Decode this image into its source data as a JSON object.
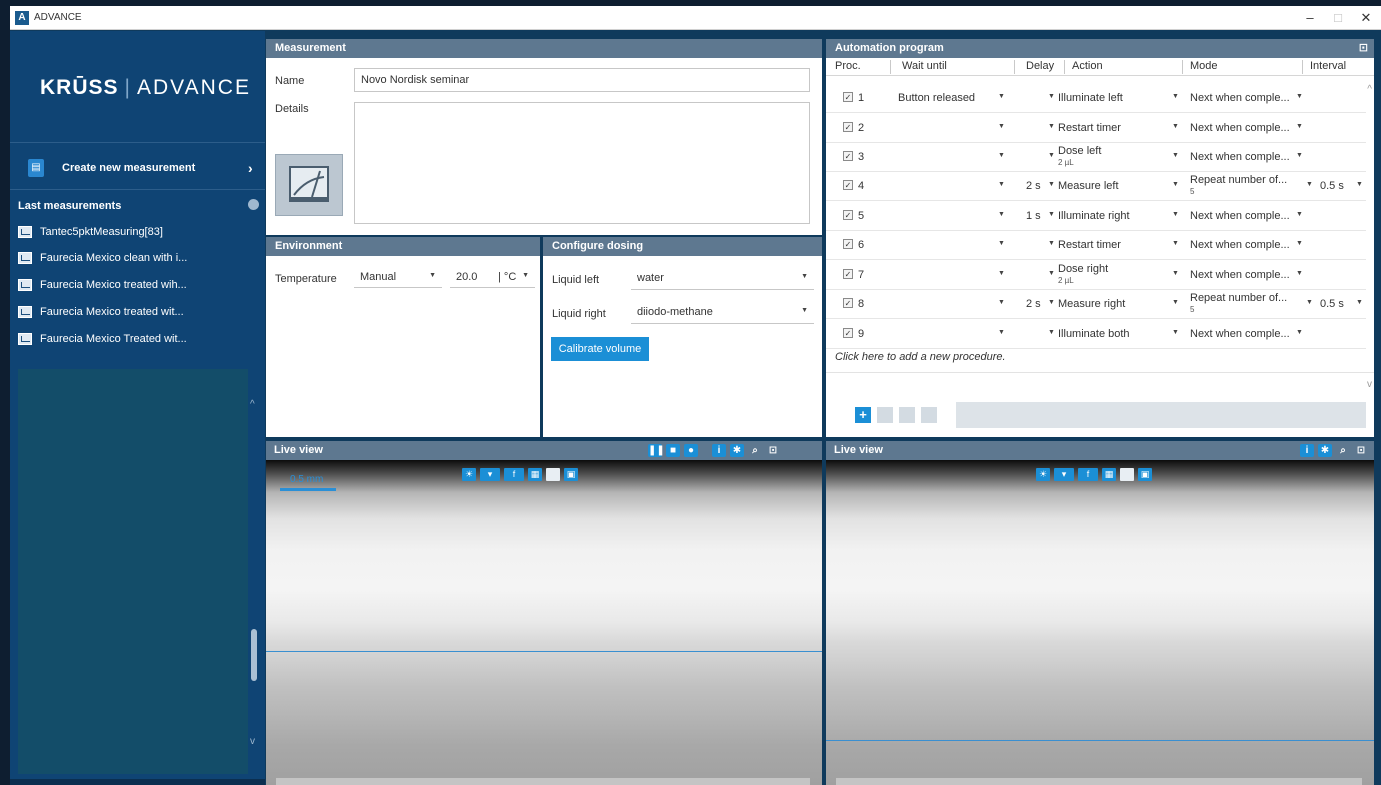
{
  "window": {
    "title": "ADVANCE",
    "app_icon_letter": "A",
    "minimize": "–",
    "maximize": "□",
    "close": "✕"
  },
  "sidebar": {
    "logo_brand": "KRŪSS",
    "logo_sep": "|",
    "logo_product": "ADVANCE",
    "create_label": "Create new measurement",
    "create_chevron": "›",
    "last_measurements_title": "Last measurements",
    "last_measurements": [
      "Tantec5pktMeasuring[83]",
      "Faurecia Mexico clean with i...",
      "Faurecia Mexico treated wih...",
      "Faurecia Mexico treated wit...",
      "Faurecia Mexico Treated wit..."
    ]
  },
  "measurement": {
    "title": "Measurement",
    "name_label": "Name",
    "name_value": "Novo Nordisk seminar",
    "details_label": "Details",
    "details_value": ""
  },
  "environment": {
    "title": "Environment",
    "temperature_label": "Temperature",
    "temperature_mode": "Manual",
    "temperature_value": "20.0",
    "temperature_unit": "| °C"
  },
  "dosing": {
    "title": "Configure dosing",
    "liquid_left_label": "Liquid left",
    "liquid_left_value": "water",
    "liquid_right_label": "Liquid right",
    "liquid_right_value": "diiodo-methane",
    "calibrate_label": "Calibrate volume"
  },
  "automation": {
    "title": "Automation program",
    "columns": [
      "Proc.",
      "Wait until",
      "Delay",
      "Action",
      "Mode",
      "Interval"
    ],
    "rows": [
      {
        "num": "1",
        "wait": "Button released",
        "delay": "",
        "action": "Illuminate left",
        "action_sub": "",
        "mode": "Next when comple...",
        "mode_sub": "",
        "interval": ""
      },
      {
        "num": "2",
        "wait": "",
        "delay": "",
        "action": "Restart timer",
        "action_sub": "",
        "mode": "Next when comple...",
        "mode_sub": "",
        "interval": ""
      },
      {
        "num": "3",
        "wait": "",
        "delay": "",
        "action": "Dose left",
        "action_sub": "2 µL",
        "mode": "Next when comple...",
        "mode_sub": "",
        "interval": ""
      },
      {
        "num": "4",
        "wait": "",
        "delay": "2 s",
        "action": "Measure left",
        "action_sub": "",
        "mode": "Repeat number of...",
        "mode_sub": "5",
        "interval": "0.5 s"
      },
      {
        "num": "5",
        "wait": "",
        "delay": "1 s",
        "action": "Illuminate right",
        "action_sub": "",
        "mode": "Next when comple...",
        "mode_sub": "",
        "interval": ""
      },
      {
        "num": "6",
        "wait": "",
        "delay": "",
        "action": "Restart timer",
        "action_sub": "",
        "mode": "Next when comple...",
        "mode_sub": "",
        "interval": ""
      },
      {
        "num": "7",
        "wait": "",
        "delay": "",
        "action": "Dose right",
        "action_sub": "2 µL",
        "mode": "Next when comple...",
        "mode_sub": "",
        "interval": ""
      },
      {
        "num": "8",
        "wait": "",
        "delay": "2 s",
        "action": "Measure right",
        "action_sub": "",
        "mode": "Repeat number of...",
        "mode_sub": "5",
        "interval": "0.5 s"
      },
      {
        "num": "9",
        "wait": "",
        "delay": "",
        "action": "Illuminate both",
        "action_sub": "",
        "mode": "Next when comple...",
        "mode_sub": "",
        "interval": ""
      }
    ],
    "add_procedure_text": "Click here to add a new procedure.",
    "add_icon": "+"
  },
  "live_left": {
    "title": "Live view",
    "scale_label": "0.5 mm"
  },
  "live_right": {
    "title": "Live view"
  },
  "colors": {
    "accent": "#1b8fd6",
    "sidebar": "#0f4474",
    "panel_header": "#5e7890"
  }
}
